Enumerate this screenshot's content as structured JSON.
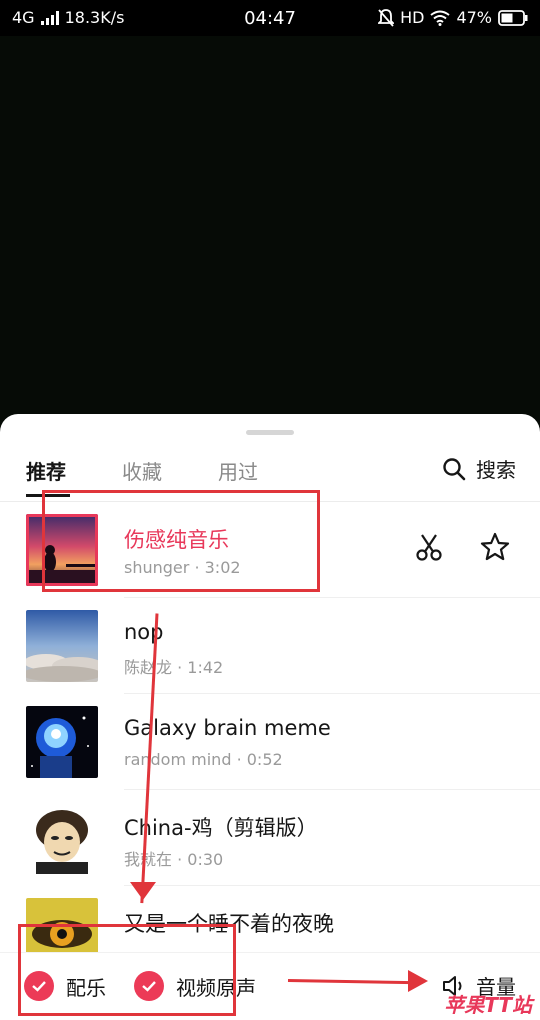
{
  "status_bar": {
    "network": "4G",
    "speed": "18.3K/s",
    "time": "04:47",
    "hd": "HD",
    "battery": "47%"
  },
  "tabs": [
    {
      "label": "推荐",
      "active": true
    },
    {
      "label": "收藏",
      "active": false
    },
    {
      "label": "用过",
      "active": false
    }
  ],
  "search": {
    "label": "搜索",
    "icon": "search-icon"
  },
  "songs": [
    {
      "title": "伤感纯音乐",
      "artist": "shunger",
      "dot": "·",
      "duration": "3:02",
      "selected": true
    },
    {
      "title": "nop",
      "artist": "陈赵龙",
      "dot": "·",
      "duration": "1:42",
      "selected": false
    },
    {
      "title": "Galaxy brain meme",
      "artist": "random mind",
      "dot": "·",
      "duration": "0:52",
      "selected": false
    },
    {
      "title": "China-鸡（剪辑版）",
      "artist": "我就在",
      "dot": "·",
      "duration": "0:30",
      "selected": false
    },
    {
      "title": "又是一个睡不着的夜晚",
      "artist": "",
      "dot": "",
      "duration": "",
      "selected": false
    }
  ],
  "bottom": {
    "music_label": "配乐",
    "original_sound_label": "视频原声",
    "volume_label": "音量"
  },
  "watermark": "苹果TT站",
  "colors": {
    "accent": "#e8385a",
    "annotation": "#e0353b"
  }
}
